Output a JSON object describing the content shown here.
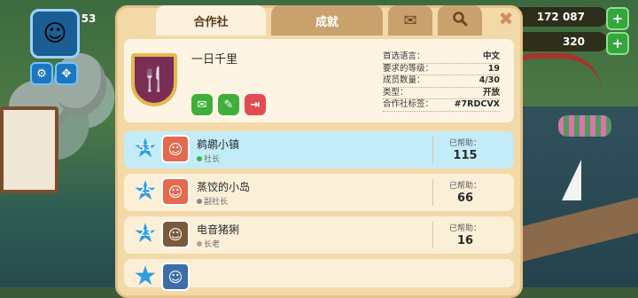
{
  "hud": {
    "player_level": "53",
    "coins": "172 087",
    "gems": "320"
  },
  "tabs": [
    {
      "label": "合作社",
      "active": true
    },
    {
      "label": "成就",
      "active": false
    },
    {
      "icon": "mail-icon"
    },
    {
      "icon": "search-icon"
    }
  ],
  "club": {
    "name": "一日千里",
    "stats": [
      {
        "label": "首选语言：",
        "value": "中文"
      },
      {
        "label": "要求的等级：",
        "value": "19"
      },
      {
        "label": "成员数量：",
        "value": "4/30"
      },
      {
        "label": "类型：",
        "value": "开放"
      },
      {
        "label": "合作社标签：",
        "value": "#7RDCVX"
      }
    ]
  },
  "members": [
    {
      "level": "53",
      "name": "鹈鹕小镇",
      "role": "社长",
      "help_label": "已帮助：",
      "help": "115",
      "dot": "#3bb54a"
    },
    {
      "level": "25",
      "name": "蒸饺的小岛",
      "role": "副社长",
      "help_label": "已帮助：",
      "help": "66",
      "dot": "#8a8a8a"
    },
    {
      "level": "23",
      "name": "电音猪猁",
      "role": "长老",
      "help_label": "已帮助：",
      "help": "16",
      "dot": "#b8a08a"
    }
  ],
  "colors": {
    "accent_blue": "#2f9de2",
    "highlight_row": "#c3ecf8",
    "panel": "#f3d9a8"
  }
}
